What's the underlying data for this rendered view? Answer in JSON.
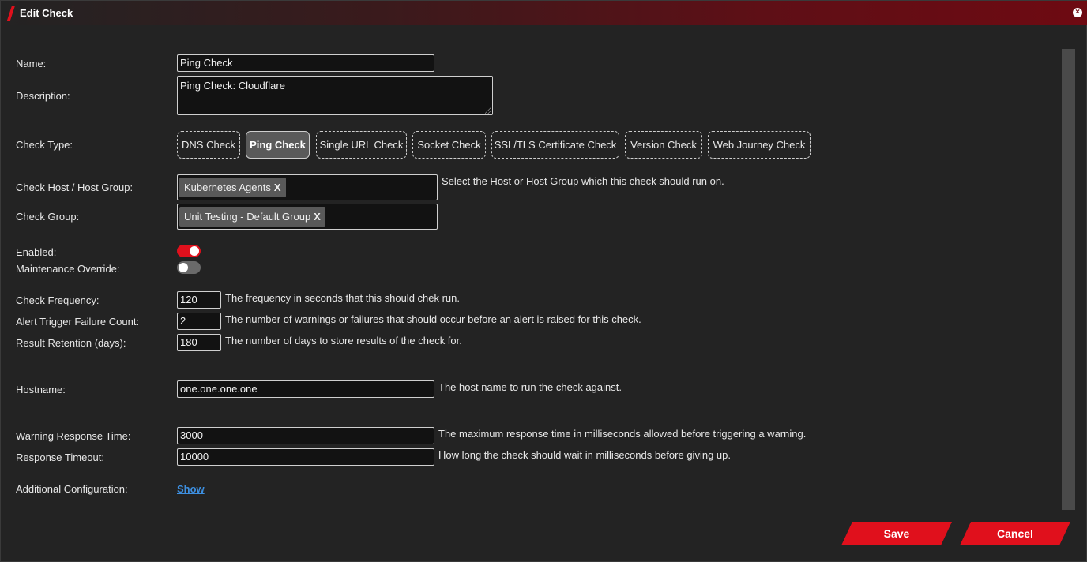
{
  "dialog": {
    "title": "Edit Check",
    "close_symbol": "×"
  },
  "form": {
    "name": {
      "label": "Name:",
      "value": "Ping Check"
    },
    "description": {
      "label": "Description:",
      "value": "Ping Check: Cloudflare"
    },
    "check_type": {
      "label": "Check Type:",
      "options": [
        "DNS Check",
        "Ping Check",
        "Single URL Check",
        "Socket Check",
        "SSL/TLS Certificate Check",
        "Version Check",
        "Web Journey Check"
      ],
      "selected": "Ping Check"
    },
    "host_group": {
      "label": "Check Host / Host Group:",
      "tag": "Kubernetes Agents",
      "tag_remove": "X",
      "help": "Select the Host or Host Group which this check should run on."
    },
    "check_group": {
      "label": "Check Group:",
      "tag": "Unit Testing - Default Group",
      "tag_remove": "X"
    },
    "enabled": {
      "label": "Enabled:",
      "on": true
    },
    "maintenance_override": {
      "label": "Maintenance Override:",
      "on": false
    },
    "frequency": {
      "label": "Check Frequency:",
      "value": "120",
      "help": "The frequency in seconds that this should chek run."
    },
    "failure_count": {
      "label": "Alert Trigger Failure Count:",
      "value": "2",
      "help": "The number of warnings or failures that should occur before an alert is raised for this check."
    },
    "retention": {
      "label": "Result Retention (days):",
      "value": "180",
      "help": "The number of days to store results of the check for."
    },
    "hostname": {
      "label": "Hostname:",
      "value": "one.one.one.one",
      "help": "The host name to run the check against."
    },
    "warning_response": {
      "label": "Warning Response Time:",
      "value": "3000",
      "help": "The maximum response time in milliseconds allowed before triggering a warning."
    },
    "response_timeout": {
      "label": "Response Timeout:",
      "value": "10000",
      "help": "How long the check should wait in milliseconds before giving up."
    },
    "additional_config": {
      "label": "Additional Configuration:",
      "link": "Show"
    }
  },
  "actions": {
    "save": "Save",
    "cancel": "Cancel"
  },
  "colors": {
    "accent": "#e0101c",
    "background": "#232323",
    "input_bg": "#121212",
    "link": "#3d8fe0"
  }
}
